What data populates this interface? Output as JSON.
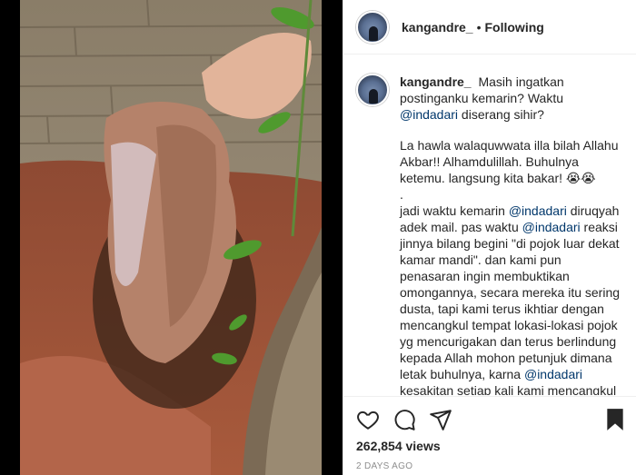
{
  "post": {
    "username": "kangandre_",
    "follow_status": "Following",
    "separator": "•"
  },
  "caption": {
    "username": "kangandre_",
    "intro_1": "Masih ingatkan postinganku kemarin? Waktu",
    "mention_1": "@indadari",
    "intro_2": "diserang sihir?",
    "para2": "La hawla walaquwwata illa bilah Allahu Akbar!! Alhamdulillah. Buhulnya ketemu. langsung kita bakar! 😭😭",
    "dot_line": ".",
    "p3_a": "jadi waktu kemarin",
    "p3_mention_a": "@indadari",
    "p3_b": "diruqyah adek mail. pas waktu",
    "p3_mention_b": "@indadari",
    "p3_c": "reaksi jinnya bilang begini \"di pojok luar dekat kamar mandi\". dan kami pun penasaran ingin membuktikan omongannya, secara mereka itu sering dusta, tapi kami terus ikhtiar dengan mencangkul tempat lokasi-lokasi pojok yg mencurigakan dan terus berlindung kepada Allah mohon petunjuk dimana letak buhulnya, karna",
    "p3_mention_c": "@indadari",
    "p3_d": "kesakitan setiap kali kami mencangkul"
  },
  "stats": {
    "views": "262,854 views",
    "time_ago": "2 DAYS AGO"
  },
  "icons": {
    "like": "heart-icon",
    "comment": "comment-icon",
    "share": "paper-plane-icon",
    "save": "bookmark-icon"
  },
  "colors": {
    "text": "#262626",
    "mention": "#00376b",
    "muted": "#8e8e8e",
    "border": "#efefef"
  }
}
